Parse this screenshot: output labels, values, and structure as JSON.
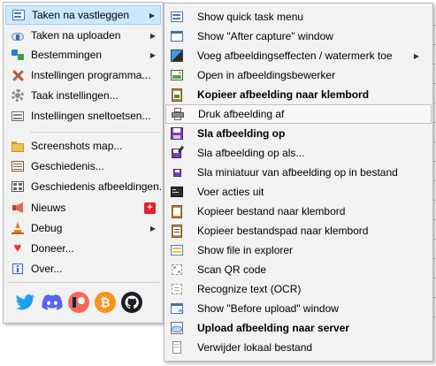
{
  "main_menu": {
    "items": [
      {
        "label": "Taken na vastleggen",
        "icon": "capture-tasks-icon",
        "has_submenu": true
      },
      {
        "label": "Taken na uploaden",
        "icon": "upload-cloud-icon",
        "has_submenu": true
      },
      {
        "label": "Bestemmingen",
        "icon": "destinations-icon",
        "has_submenu": true
      },
      {
        "label": "Instellingen programma...",
        "icon": "tools-icon",
        "has_submenu": false
      },
      {
        "label": "Taak instellingen...",
        "icon": "gear-icon",
        "has_submenu": false
      },
      {
        "label": "Instellingen sneltoetsen...",
        "icon": "keyboard-icon",
        "has_submenu": false
      },
      {
        "label": "Screenshots map...",
        "icon": "folder-icon",
        "has_submenu": false
      },
      {
        "label": "Geschiedenis...",
        "icon": "history-icon",
        "has_submenu": false
      },
      {
        "label": "Geschiedenis afbeeldingen...",
        "icon": "image-history-icon",
        "has_submenu": false
      },
      {
        "label": "Nieuws",
        "icon": "megaphone-icon",
        "has_submenu": false,
        "badge": "+"
      },
      {
        "label": "Debug",
        "icon": "traffic-cone-icon",
        "has_submenu": true
      },
      {
        "label": "Doneer...",
        "icon": "heart-icon",
        "has_submenu": false
      },
      {
        "label": "Over...",
        "icon": "info-icon",
        "has_submenu": false
      }
    ],
    "social": [
      "twitter-icon",
      "discord-icon",
      "patreon-icon",
      "bitcoin-icon",
      "github-icon"
    ]
  },
  "sub_menu": {
    "items": [
      {
        "label": "Show quick task menu",
        "icon": "quick-task-icon",
        "bold": false
      },
      {
        "label": "Show \"After capture\" window",
        "icon": "window-icon",
        "bold": false
      },
      {
        "label": "Voeg afbeeldingseffecten / watermerk toe",
        "icon": "effects-icon",
        "bold": false,
        "has_submenu": true
      },
      {
        "label": "Open in afbeeldingsbewerker",
        "icon": "image-editor-icon",
        "bold": false
      },
      {
        "label": "Kopieer afbeelding naar klembord",
        "icon": "clipboard-image-icon",
        "bold": true
      },
      {
        "label": "Druk afbeelding af",
        "icon": "printer-icon",
        "bold": false
      },
      {
        "label": "Sla afbeelding op",
        "icon": "save-icon",
        "bold": true
      },
      {
        "label": "Sla afbeelding op als...",
        "icon": "save-as-icon",
        "bold": false
      },
      {
        "label": "Sla miniatuur van afbeelding op in bestand",
        "icon": "save-thumbnail-icon",
        "bold": false
      },
      {
        "label": "Voer acties uit",
        "icon": "terminal-icon",
        "bold": false
      },
      {
        "label": "Kopieer bestand naar klembord",
        "icon": "clipboard-file-icon",
        "bold": false
      },
      {
        "label": "Kopieer bestandspad naar klembord",
        "icon": "clipboard-path-icon",
        "bold": false
      },
      {
        "label": "Show file in explorer",
        "icon": "explorer-icon",
        "bold": false
      },
      {
        "label": "Scan QR code",
        "icon": "qr-code-icon",
        "bold": false
      },
      {
        "label": "Recognize text (OCR)",
        "icon": "ocr-icon",
        "bold": false
      },
      {
        "label": "Show \"Before upload\" window",
        "icon": "before-upload-icon",
        "bold": false
      },
      {
        "label": "Upload afbeelding naar server",
        "icon": "upload-server-icon",
        "bold": true
      },
      {
        "label": "Verwijder lokaal bestand",
        "icon": "delete-file-icon",
        "bold": false
      }
    ]
  },
  "colors": {
    "menu_bg": "#f2f2f2",
    "hover_bg": "#cce8ff",
    "hover_border": "#99d1ff",
    "badge": "#e5202a"
  }
}
